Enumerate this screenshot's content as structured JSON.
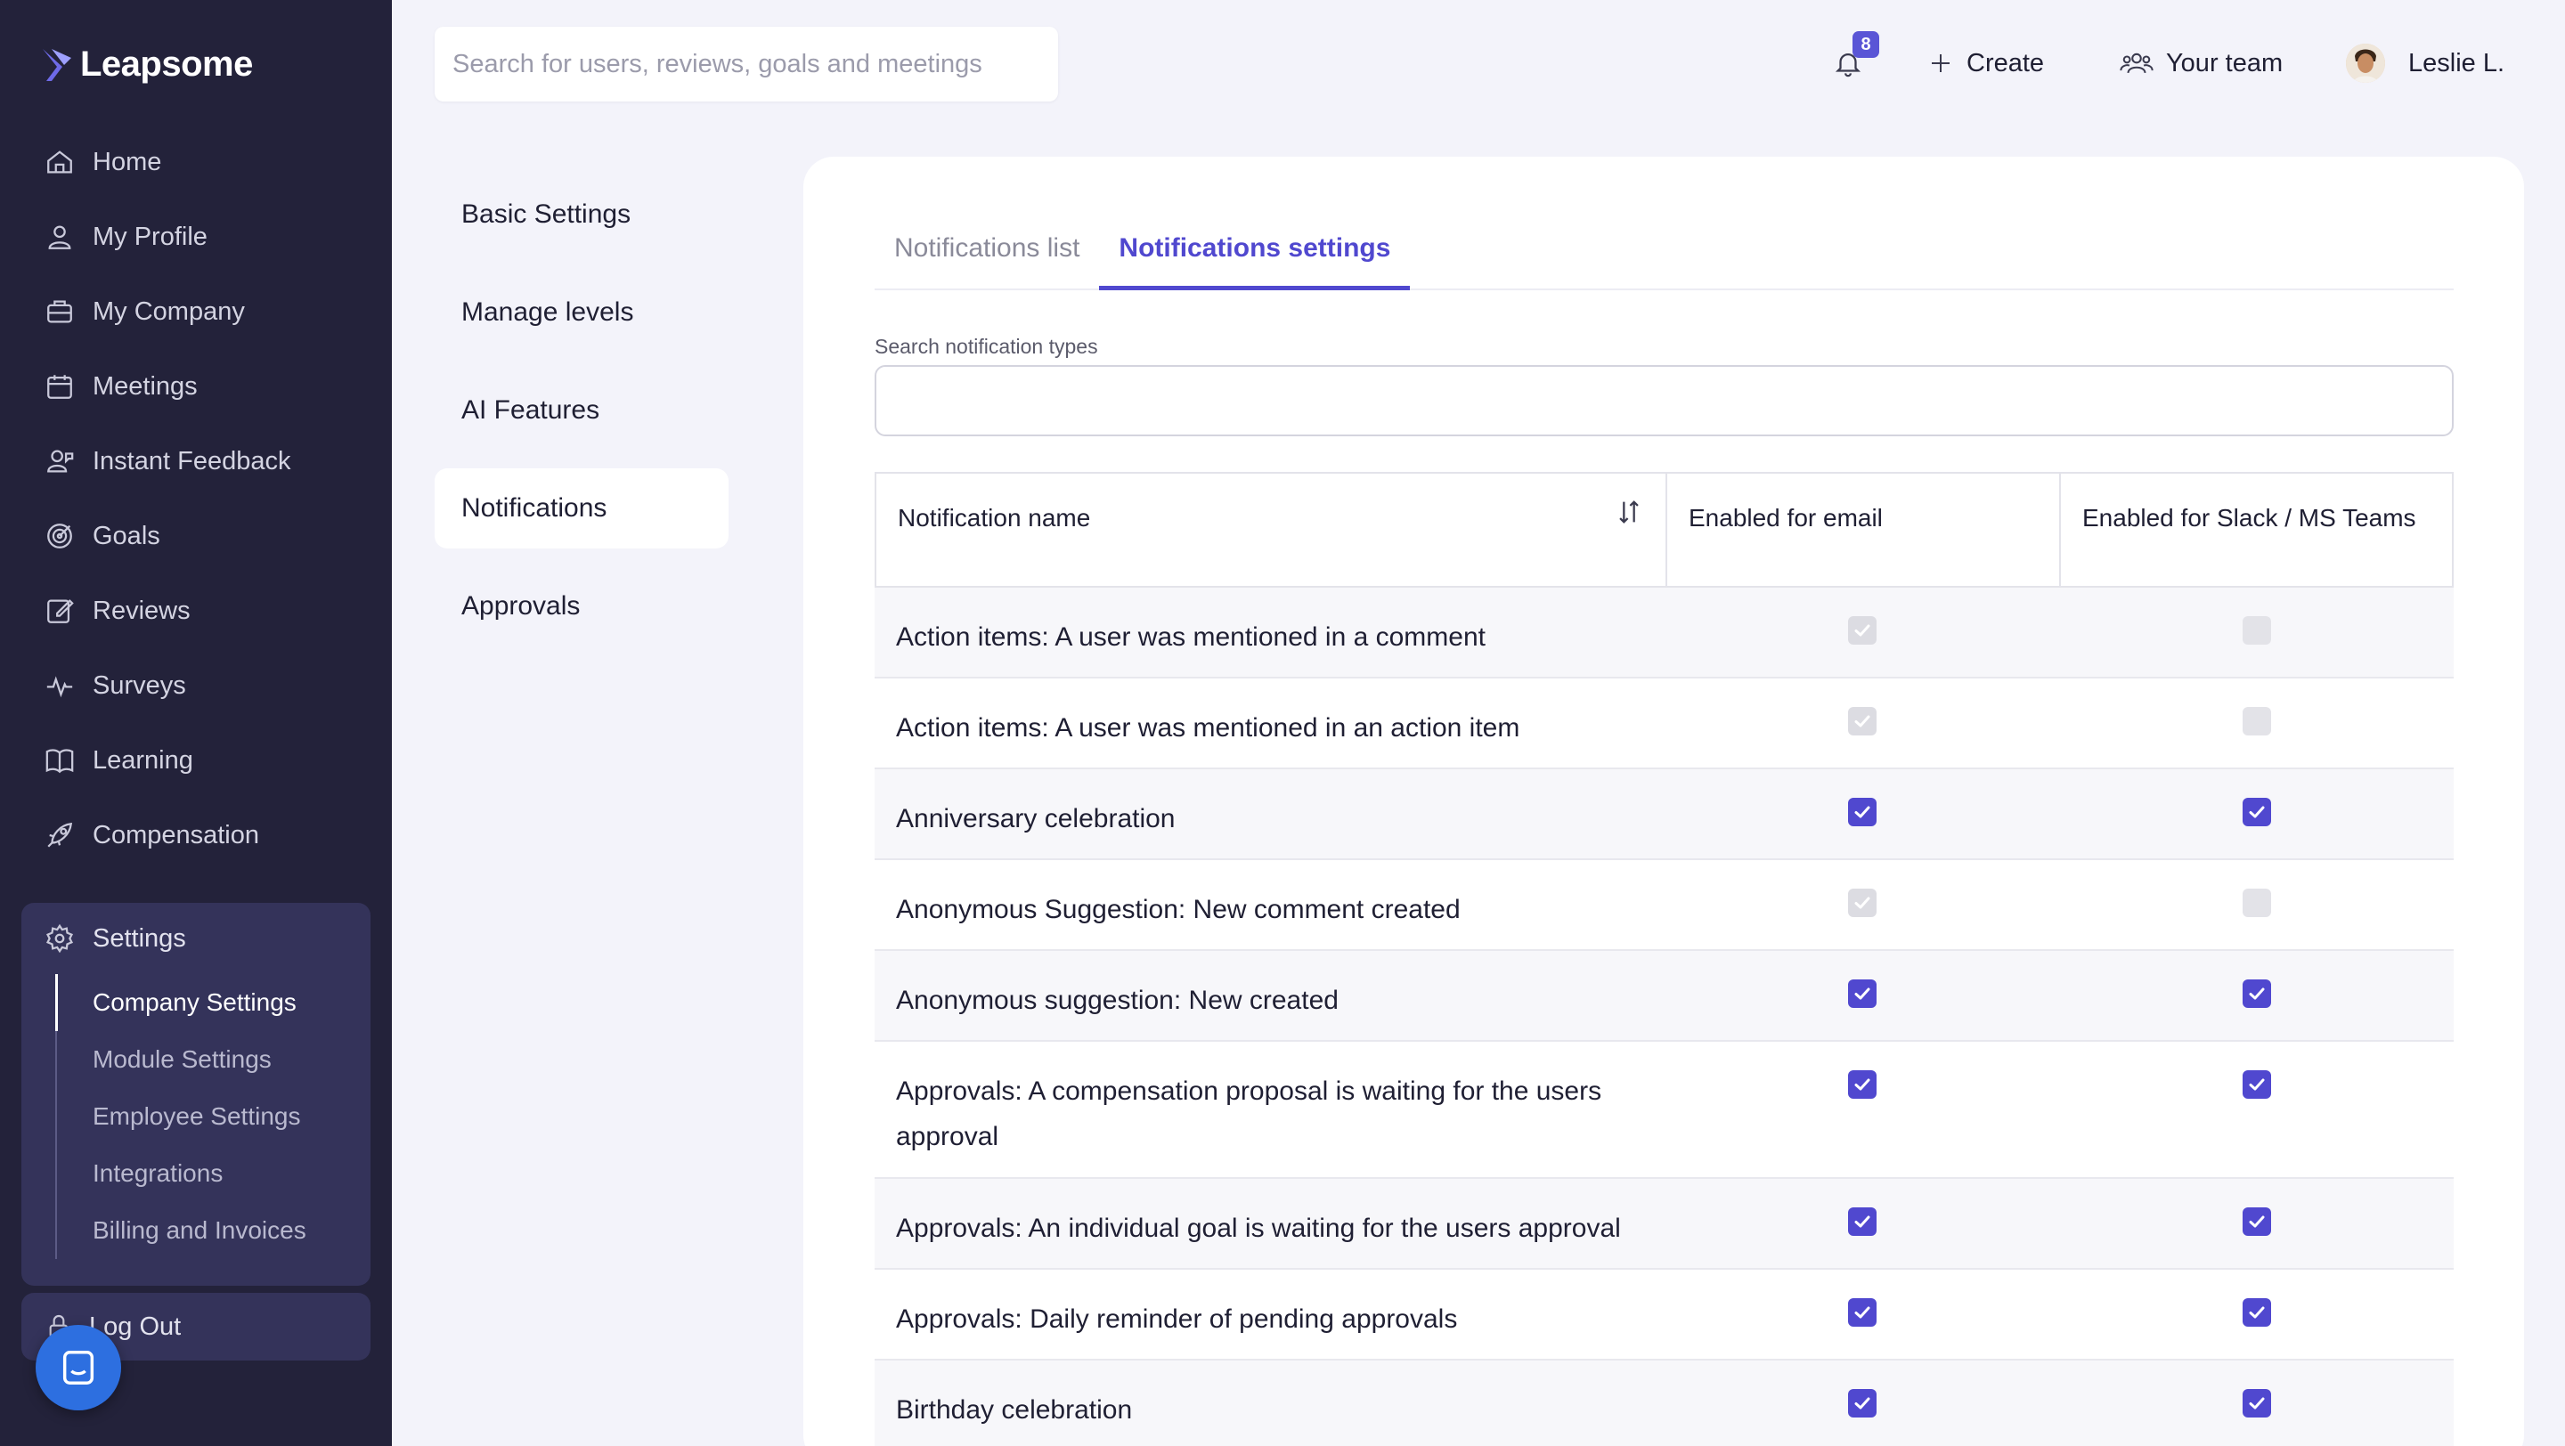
{
  "brand": {
    "name": "Leapsome",
    "accent": "#5048cf",
    "sidebar_bg": "#23223a"
  },
  "sidebar": {
    "items": [
      {
        "label": "Home",
        "icon": "home-icon"
      },
      {
        "label": "My Profile",
        "icon": "user-icon"
      },
      {
        "label": "My Company",
        "icon": "briefcase-icon"
      },
      {
        "label": "Meetings",
        "icon": "calendar-icon"
      },
      {
        "label": "Instant Feedback",
        "icon": "feedback-icon"
      },
      {
        "label": "Goals",
        "icon": "target-icon"
      },
      {
        "label": "Reviews",
        "icon": "edit-icon"
      },
      {
        "label": "Surveys",
        "icon": "pulse-icon"
      },
      {
        "label": "Learning",
        "icon": "book-icon"
      },
      {
        "label": "Compensation",
        "icon": "rocket-icon"
      }
    ],
    "settings": {
      "label": "Settings",
      "icon": "gear-icon",
      "sub_items": [
        "Company Settings",
        "Module Settings",
        "Employee Settings",
        "Integrations",
        "Billing and Invoices"
      ],
      "active": "Company Settings"
    },
    "logout": "Log Out"
  },
  "topbar": {
    "search_placeholder": "Search for users, reviews, goals and meetings",
    "notification_count": "8",
    "create_label": "Create",
    "team_label": "Your team",
    "user_name": "Leslie L."
  },
  "subnav": {
    "items": [
      "Basic Settings",
      "Manage levels",
      "AI Features",
      "Notifications",
      "Approvals"
    ],
    "active": "Notifications"
  },
  "tabs": [
    {
      "label": "Notifications list",
      "active": false
    },
    {
      "label": "Notifications settings",
      "active": true
    }
  ],
  "search_types": {
    "label": "Search notification types",
    "value": ""
  },
  "table": {
    "columns": [
      "Notification name",
      "Enabled for email",
      "Enabled for Slack / MS Teams"
    ],
    "rows": [
      {
        "name": "Action items: A user was mentioned in a comment",
        "email": "disabled-checked",
        "slack": "disabled-unchecked"
      },
      {
        "name": "Action items: A user was mentioned in an action item",
        "email": "disabled-checked",
        "slack": "disabled-unchecked"
      },
      {
        "name": "Anniversary celebration",
        "email": "checked",
        "slack": "checked"
      },
      {
        "name": "Anonymous Suggestion: New comment created",
        "email": "disabled-checked",
        "slack": "disabled-unchecked"
      },
      {
        "name": "Anonymous suggestion: New created",
        "email": "checked",
        "slack": "checked"
      },
      {
        "name": "Approvals: A compensation proposal is waiting for the users approval",
        "email": "checked",
        "slack": "checked"
      },
      {
        "name": "Approvals: An individual goal is waiting for the users approval",
        "email": "checked",
        "slack": "checked"
      },
      {
        "name": "Approvals: Daily reminder of pending approvals",
        "email": "checked",
        "slack": "checked"
      },
      {
        "name": "Birthday celebration",
        "email": "checked",
        "slack": "checked"
      }
    ]
  }
}
